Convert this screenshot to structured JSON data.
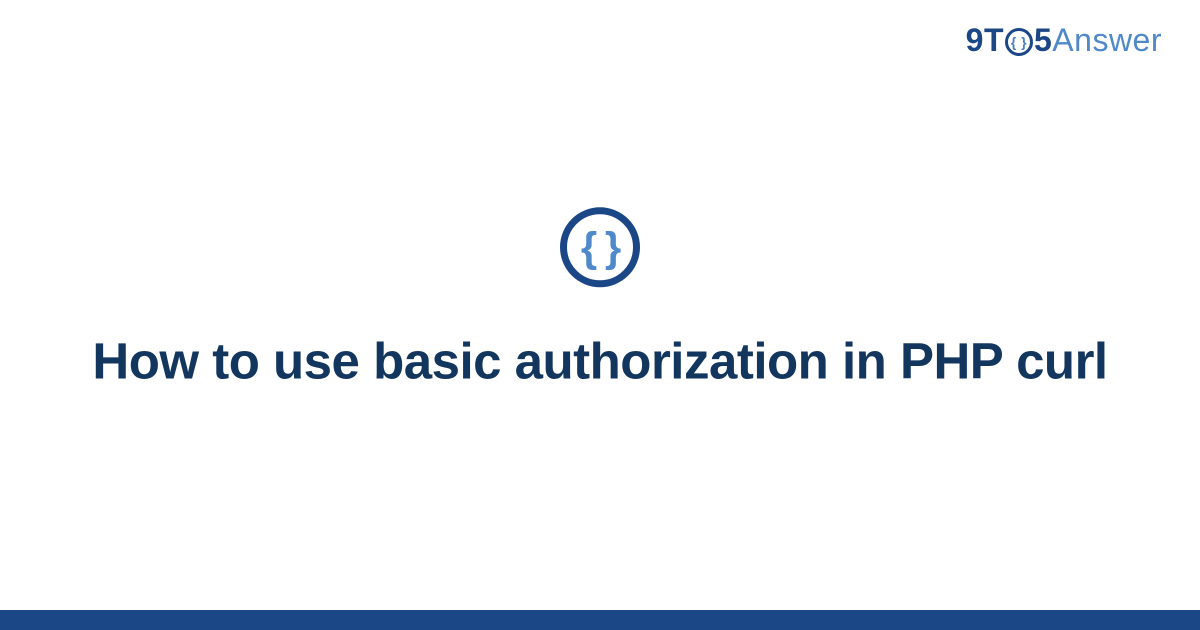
{
  "logo": {
    "part1": "9T",
    "icon_inner": "{ }",
    "part2": "5",
    "part3": "Answer"
  },
  "center": {
    "icon_braces": "{ }",
    "title": "How to use basic authorization in PHP curl"
  },
  "colors": {
    "brand_dark": "#1c4786",
    "brand_light": "#5089c9",
    "title": "#13365f"
  }
}
